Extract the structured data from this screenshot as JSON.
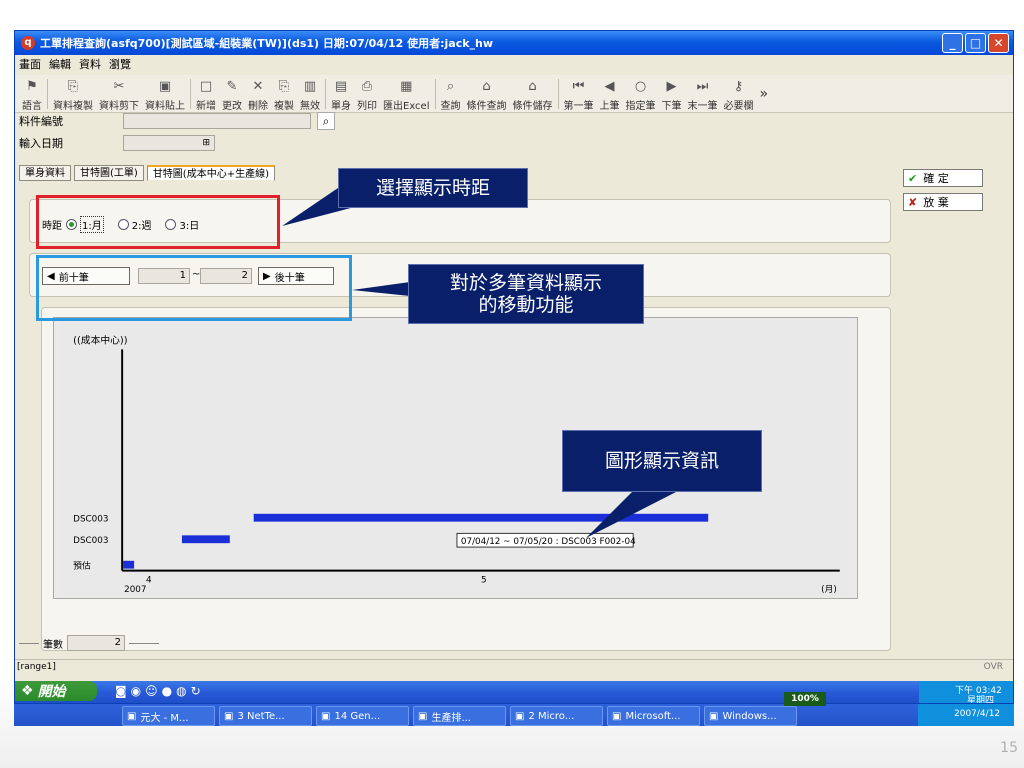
{
  "window": {
    "title": "工單排程查詢(asfq700)[測試區域-組裝業(TW)](ds1) 日期:07/04/12 使用者:jack_hw",
    "app_icon": "q"
  },
  "menu": [
    "畫面",
    "編輯",
    "資料",
    "瀏覽"
  ],
  "toolbar": [
    {
      "icon": "flag-icon",
      "glyph": "⚑",
      "label": "語言"
    },
    {
      "icon": "copy-icon",
      "glyph": "⎘",
      "label": "資料複製"
    },
    {
      "icon": "cut-icon",
      "glyph": "✂",
      "label": "資料剪下"
    },
    {
      "icon": "paste-icon",
      "glyph": "▣",
      "label": "資料貼上"
    },
    {
      "icon": "new-icon",
      "glyph": "□",
      "label": "新增"
    },
    {
      "icon": "edit-icon",
      "glyph": "✎",
      "label": "更改"
    },
    {
      "icon": "delete-icon",
      "glyph": "✕",
      "label": "刪除"
    },
    {
      "icon": "duplicate-icon",
      "glyph": "⎘",
      "label": "複製"
    },
    {
      "icon": "invalid-icon",
      "glyph": "▥",
      "label": "無效"
    },
    {
      "icon": "single-icon",
      "glyph": "▤",
      "label": "單身"
    },
    {
      "icon": "print-icon",
      "glyph": "⎙",
      "label": "列印"
    },
    {
      "icon": "excel-icon",
      "glyph": "▦",
      "label": "匯出Excel"
    },
    {
      "icon": "query-icon",
      "glyph": "⌕",
      "label": "查詢"
    },
    {
      "icon": "cond-query-icon",
      "glyph": "⌂",
      "label": "條件查詢"
    },
    {
      "icon": "cond-save-icon",
      "glyph": "⌂",
      "label": "條件儲存"
    },
    {
      "icon": "first-icon",
      "glyph": "⏮",
      "label": "第一筆"
    },
    {
      "icon": "prev-icon",
      "glyph": "◀",
      "label": "上筆"
    },
    {
      "icon": "goto-icon",
      "glyph": "○",
      "label": "指定筆"
    },
    {
      "icon": "next-icon",
      "glyph": "▶",
      "label": "下筆"
    },
    {
      "icon": "last-icon",
      "glyph": "⏭",
      "label": "末一筆"
    },
    {
      "icon": "key-icon",
      "glyph": "⚷",
      "label": "必要欄"
    }
  ],
  "overflow_glyph": "»",
  "form": {
    "part_no_label": "料件編號",
    "input_date_label": "輸入日期",
    "date_icon": "⊞"
  },
  "side": {
    "confirm": "確 定",
    "cancel": "放 棄"
  },
  "tabs": [
    "單身資料",
    "甘特圖(工單)",
    "甘特圖(成本中心+生產線)"
  ],
  "period": {
    "label": "時距",
    "options": [
      "1:月",
      "2:週",
      "3:日"
    ],
    "selected": 0
  },
  "nav": {
    "prev": "前十筆",
    "next": "後十筆",
    "from": "1",
    "sep": "~",
    "to": "2"
  },
  "chart_data": {
    "type": "gantt",
    "ylabel": "((成本中心))",
    "xlabel": "(月)",
    "year": "2007",
    "xticks": [
      "4",
      "5"
    ],
    "xrange": [
      "2007/04/01",
      "2007/05/31"
    ],
    "rows": [
      "DSC003",
      "DSC003",
      "預估"
    ],
    "bars": [
      {
        "row": 0,
        "start": "2007/04/12",
        "end": "2007/05/20"
      },
      {
        "row": 1,
        "start": "2007/04/06",
        "end": "2007/04/10"
      },
      {
        "row": 2,
        "start": "2007/03/31",
        "end": "2007/04/02"
      }
    ],
    "tooltip": "07/04/12 ~ 07/05/20 : DSC003 F002-04",
    "bar_color": "#1a2fd8"
  },
  "footer": {
    "count_label": "筆數",
    "count_value": "2",
    "range": "[range1]",
    "ovr": "OVR"
  },
  "callouts": {
    "period": "選擇顯示時距",
    "nav": "對於多筆資料顯示\n的移動功能",
    "chart": "圖形顯示資訊"
  },
  "taskbar": {
    "start": "開始",
    "items": [
      "元大 - M...",
      "3 NetTe...",
      "14 Gen...",
      "生產排...",
      "2 Micro...",
      "Microsoft...",
      "Windows..."
    ],
    "battery": "100%",
    "time": "下午 03:42",
    "weekday": "星期四",
    "date": "2007/4/12"
  },
  "slide_number": "15"
}
